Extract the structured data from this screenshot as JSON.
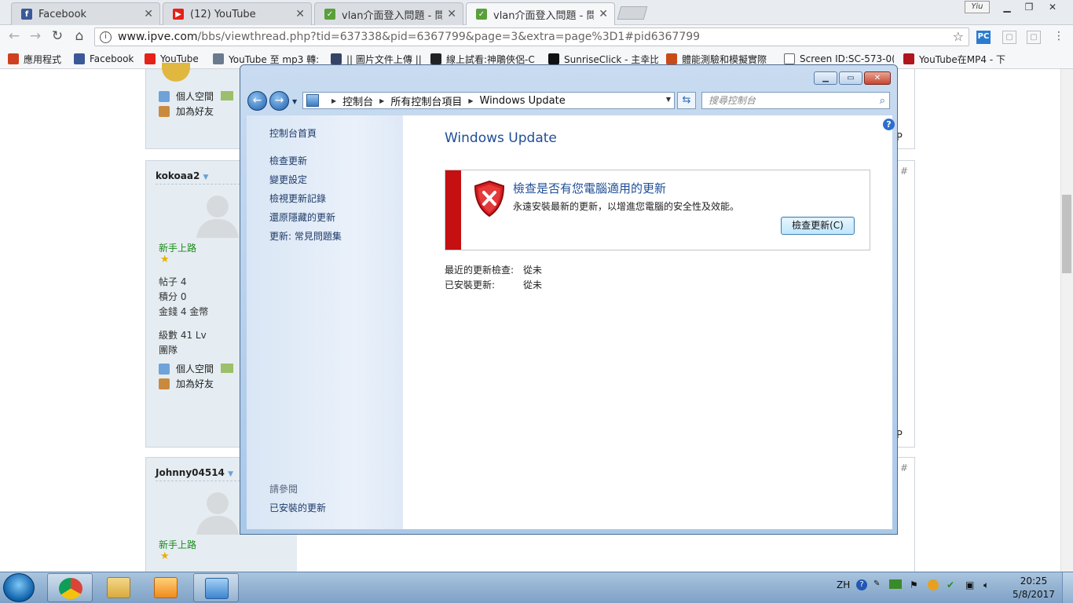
{
  "browser": {
    "tabs": [
      {
        "label": "Facebook",
        "icon": "facebook-icon",
        "color": "#3b5998",
        "glyph": "f"
      },
      {
        "label": "(12) YouTube",
        "icon": "youtube-icon",
        "color": "#e62117",
        "glyph": "▶"
      },
      {
        "label": "vlan介面登入問題 - 問題",
        "icon": "ipve-icon",
        "color": "#5aa03a",
        "glyph": "✓"
      },
      {
        "label": "vlan介面登入問題 - 問題",
        "icon": "ipve-icon",
        "color": "#5aa03a",
        "glyph": "✓"
      }
    ],
    "user_badge": "Yiu",
    "url_host": "www.ipve.com",
    "url_rest": "/bbs/viewthread.php?tid=637338&pid=6367799&page=3&extra=page%3D1#pid6367799",
    "bookmarks": [
      {
        "label": "應用程式",
        "icon": "apps-grid-icon",
        "color": "#d04020"
      },
      {
        "label": "Facebook",
        "icon": "facebook-icon",
        "color": "#3b5998"
      },
      {
        "label": "YouTube",
        "icon": "youtube-icon",
        "color": "#e62117"
      },
      {
        "label": "YouTube 至 mp3 轉:",
        "icon": "mp3-icon",
        "color": "#6b7a8f"
      },
      {
        "label": "|| 圖片文件上傳 ||",
        "icon": "grid-icon",
        "color": "#334466"
      },
      {
        "label": "線上試看:神鵰俠侶-C",
        "icon": "film-icon",
        "color": "#222222"
      },
      {
        "label": "SunriseClick - 主幸比",
        "icon": "skull-icon",
        "color": "#111111"
      },
      {
        "label": "體能測驗和模擬實際",
        "icon": "badge-icon",
        "color": "#c84a1a"
      },
      {
        "label": "Screen ID:SC-573-0(",
        "icon": "page-icon",
        "color": "#ffffff"
      },
      {
        "label": "YouTube在MP4 - 下",
        "icon": "pause-icon",
        "color": "#b0141c"
      }
    ]
  },
  "forum": {
    "posts": [
      {
        "username": "",
        "links": [
          "個人空間",
          "加為好友"
        ],
        "right_mark": "P"
      },
      {
        "username": "kokoaa2",
        "rank": "新手上路",
        "stats": [
          {
            "label": "帖子",
            "value": "4"
          },
          {
            "label": "積分",
            "value": "0"
          },
          {
            "label": "金錢",
            "value": "4 金幣"
          },
          {
            "label": "級數",
            "value": "41 Lv"
          },
          {
            "label": "團隊",
            "value": ""
          }
        ],
        "links": [
          "個人空間",
          "加為好友"
        ],
        "right_mark": "P",
        "floor_mark": "#"
      },
      {
        "username": "Johnny04514",
        "rank": "新手上路",
        "floor_mark": "#"
      }
    ]
  },
  "window": {
    "breadcrumb": [
      "控制台",
      "所有控制台項目",
      "Windows Update"
    ],
    "search_placeholder": "搜尋控制台",
    "nav_links": [
      "控制台首頁",
      "檢查更新",
      "變更設定",
      "檢視更新記錄",
      "還原隱藏的更新",
      "更新: 常見問題集"
    ],
    "see_also_header": "請參閱",
    "see_also_links": [
      "已安裝的更新"
    ],
    "title": "Windows Update",
    "status_title": "檢查是否有您電腦適用的更新",
    "status_desc": "永遠安裝最新的更新，以增進您電腦的安全性及效能。",
    "check_button": "檢查更新(C)",
    "info": [
      {
        "label": "最近的更新檢查:",
        "value": "從未"
      },
      {
        "label": "已安裝更新:",
        "value": "從未"
      }
    ],
    "accent_color": "#1e4e96",
    "alert_color": "#c50f10"
  },
  "taskbar": {
    "lang": "ZH",
    "time": "20:25",
    "date": "5/8/2017"
  }
}
